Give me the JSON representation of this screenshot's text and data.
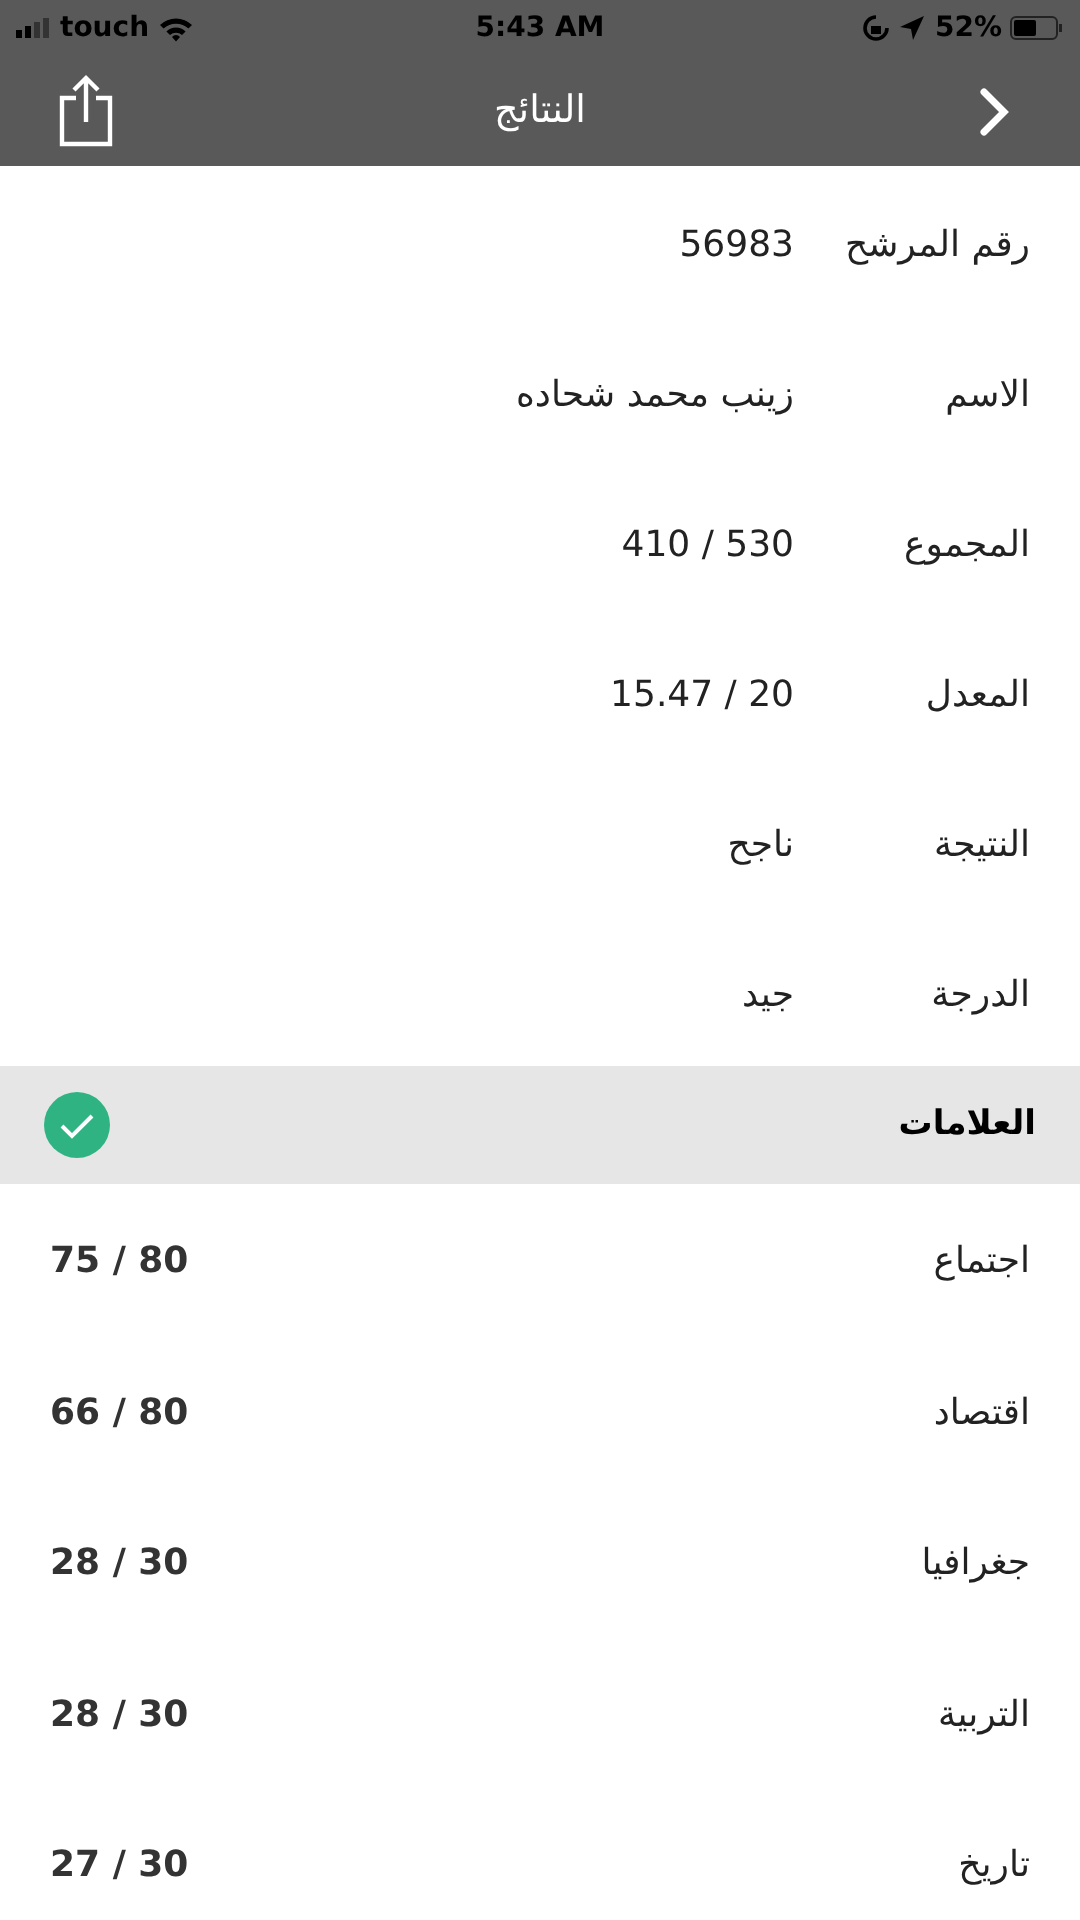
{
  "status_bar": {
    "carrier": "touch",
    "time": "5:43 AM",
    "battery": "52%"
  },
  "nav": {
    "title": "النتائج"
  },
  "details": [
    {
      "label": "رقم المرشح",
      "value": "56983"
    },
    {
      "label": "الاسم",
      "value": "زينب محمد شحاده"
    },
    {
      "label": "المجموع",
      "value": "410 / 530"
    },
    {
      "label": "المعدل",
      "value": "15.47 / 20"
    },
    {
      "label": "النتيجة",
      "value": "ناجح"
    },
    {
      "label": "الدرجة",
      "value": "جيد"
    }
  ],
  "section": {
    "title": "العلامات"
  },
  "marks": [
    {
      "subject": "اجتماع",
      "score": "75 / 80"
    },
    {
      "subject": "اقتصاد",
      "score": "66 / 80"
    },
    {
      "subject": "جغرافيا",
      "score": "28 / 30"
    },
    {
      "subject": "التربية",
      "score": "28 / 30"
    },
    {
      "subject": "تاريخ",
      "score": "27 / 30"
    }
  ]
}
